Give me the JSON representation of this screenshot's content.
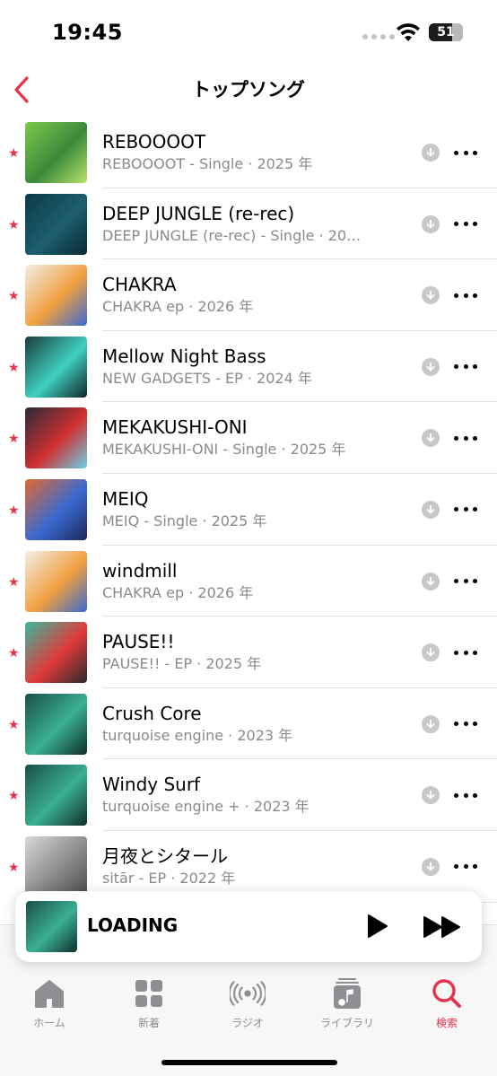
{
  "status_bar": {
    "time": "19:45",
    "battery": "51"
  },
  "nav": {
    "title": "トップソング"
  },
  "songs": [
    {
      "title": "REBOOOOT",
      "subtitle": "REBOOOOT - Single · 2025 年",
      "art": [
        "#7ec84a",
        "#3a8a3a",
        "#b7e36a"
      ]
    },
    {
      "title": "DEEP JUNGLE (re-rec)",
      "subtitle": "DEEP JUNGLE (re-rec) - Single · 20…",
      "art": [
        "#0c3a48",
        "#1d5e6e",
        "#0a2a34"
      ]
    },
    {
      "title": "CHAKRA",
      "subtitle": "CHAKRA ep · 2026 年",
      "art": [
        "#f2efe8",
        "#f0a040",
        "#3a6ad0"
      ]
    },
    {
      "title": "Mellow Night Bass",
      "subtitle": "NEW GADGETS - EP · 2024 年",
      "art": [
        "#1a3d3a",
        "#3fd0c0",
        "#0e2826"
      ]
    },
    {
      "title": "MEKAKUSHI-ONI",
      "subtitle": "MEKAKUSHI-ONI - Single · 2025 年",
      "art": [
        "#2a2a3a",
        "#d03030",
        "#6ad0e8"
      ]
    },
    {
      "title": "MEIQ",
      "subtitle": "MEIQ - Single · 2025 年",
      "art": [
        "#e06a30",
        "#3a6ad0",
        "#1a2a5a"
      ]
    },
    {
      "title": "windmill",
      "subtitle": "CHAKRA ep · 2026 年",
      "art": [
        "#f2efe8",
        "#f0a040",
        "#3a6ad0"
      ]
    },
    {
      "title": "PAUSE!!",
      "subtitle": "PAUSE!! - EP · 2025 年",
      "art": [
        "#3ab8a0",
        "#e03a3a",
        "#2a2a2a"
      ]
    },
    {
      "title": "Crush Core",
      "subtitle": "turquoise engine · 2023 年",
      "art": [
        "#1a5048",
        "#3ab090",
        "#0e2e2a"
      ]
    },
    {
      "title": "Windy Surf",
      "subtitle": "turquoise engine + · 2023 年",
      "art": [
        "#1a5048",
        "#3ab090",
        "#0e2e2a"
      ]
    },
    {
      "title": "月夜とシタール",
      "subtitle": "sitār - EP · 2022 年",
      "art": [
        "#d8d8d8",
        "#8a8a8a",
        "#4a4a4a"
      ]
    }
  ],
  "mini_player": {
    "title": "LOADING"
  },
  "tabs": [
    {
      "label": "ホーム",
      "icon": "home-icon",
      "active": false
    },
    {
      "label": "新着",
      "icon": "grid-icon",
      "active": false
    },
    {
      "label": "ラジオ",
      "icon": "radio-icon",
      "active": false
    },
    {
      "label": "ライブラリ",
      "icon": "library-icon",
      "active": false
    },
    {
      "label": "検索",
      "icon": "search-icon",
      "active": true
    }
  ],
  "colors": {
    "accent": "#e8314a",
    "secondary_text": "#8a8a8e",
    "tab_inactive": "#8e8e93"
  }
}
